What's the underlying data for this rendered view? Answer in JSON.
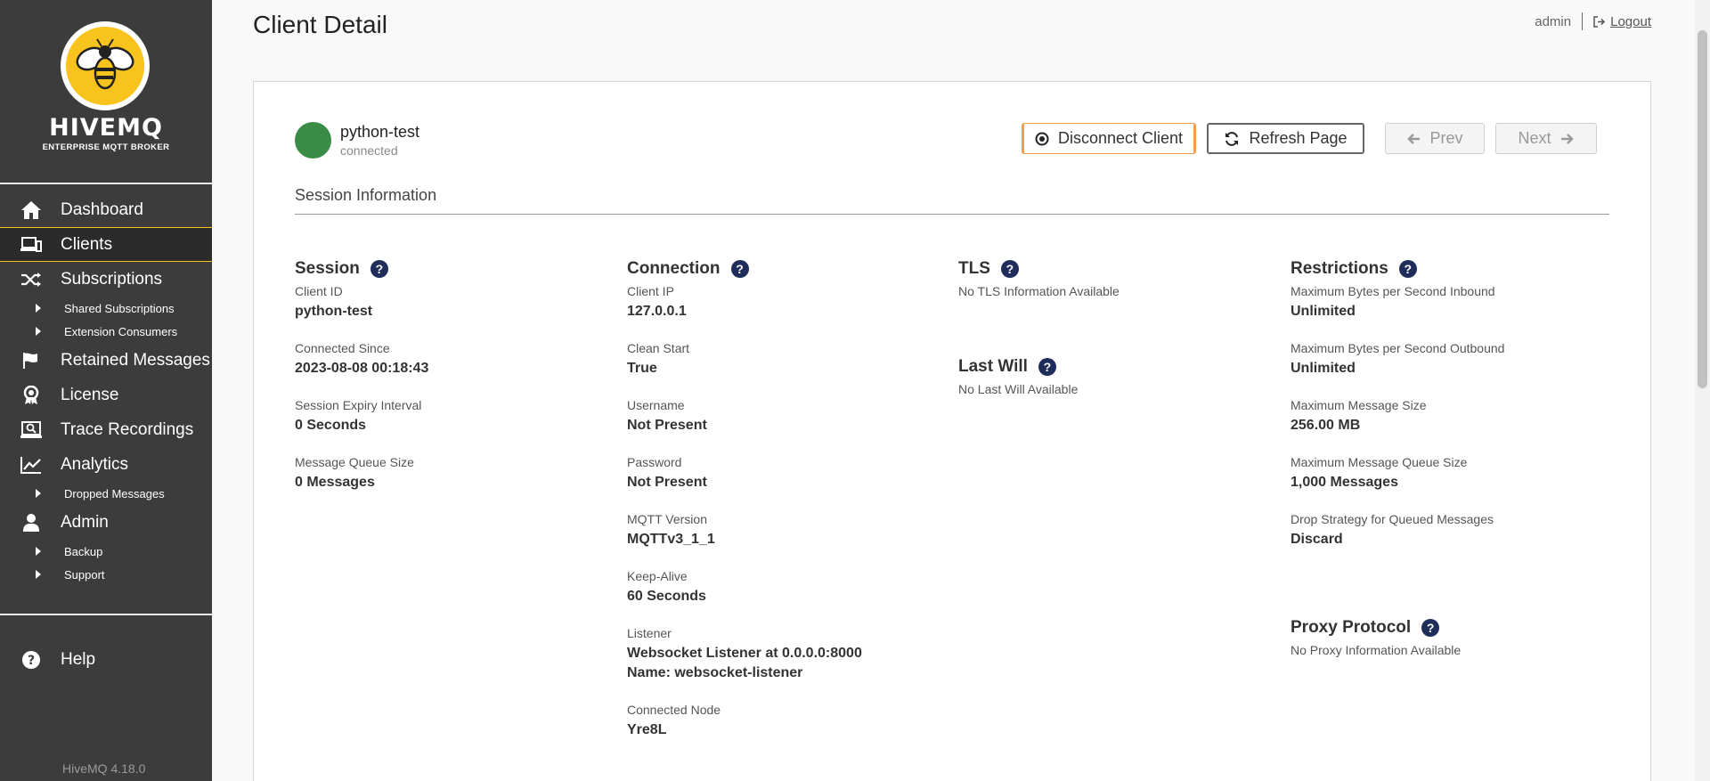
{
  "brand": {
    "name": "HIVEMQ",
    "subtitle": "ENTERPRISE MQTT BROKER",
    "accent": "#f7c31c",
    "sidebar_bg": "#3c3c3c"
  },
  "sidebar": {
    "items": [
      {
        "label": "Dashboard",
        "icon": "home-icon"
      },
      {
        "label": "Clients",
        "icon": "clients-icon",
        "active": true
      },
      {
        "label": "Subscriptions",
        "icon": "shuffle-icon"
      },
      {
        "label": "Shared Subscriptions",
        "sub": true
      },
      {
        "label": "Extension Consumers",
        "sub": true
      },
      {
        "label": "Retained Messages",
        "icon": "flag-icon"
      },
      {
        "label": "License",
        "icon": "award-icon"
      },
      {
        "label": "Trace Recordings",
        "icon": "trace-icon"
      },
      {
        "label": "Analytics",
        "icon": "line-chart-icon"
      },
      {
        "label": "Dropped Messages",
        "sub": true
      },
      {
        "label": "Admin",
        "icon": "user-icon"
      },
      {
        "label": "Backup",
        "sub": true
      },
      {
        "label": "Support",
        "sub": true
      }
    ],
    "help": "Help",
    "version": "HiveMQ 4.18.0"
  },
  "header": {
    "title": "Client Detail",
    "user": "admin",
    "logout": "Logout"
  },
  "client": {
    "id": "python-test",
    "status": "connected",
    "status_color": "#3a8b45"
  },
  "buttons": {
    "disconnect": "Disconnect Client",
    "refresh": "Refresh Page",
    "prev": "Prev",
    "next": "Next"
  },
  "section_title": "Session Information",
  "session": {
    "title": "Session",
    "fields": [
      {
        "label": "Client ID",
        "value": "python-test"
      },
      {
        "label": "Connected Since",
        "value": "2023-08-08 00:18:43"
      },
      {
        "label": "Session Expiry Interval",
        "value": "0 Seconds"
      },
      {
        "label": "Message Queue Size",
        "value": "0 Messages"
      }
    ]
  },
  "connection": {
    "title": "Connection",
    "fields": [
      {
        "label": "Client IP",
        "value": "127.0.0.1"
      },
      {
        "label": "Clean Start",
        "value": "True"
      },
      {
        "label": "Username",
        "value": "Not Present"
      },
      {
        "label": "Password",
        "value": "Not Present"
      },
      {
        "label": "MQTT Version",
        "value": "MQTTv3_1_1"
      },
      {
        "label": "Keep-Alive",
        "value": "60 Seconds"
      },
      {
        "label": "Listener",
        "value": "Websocket Listener at 0.0.0.0:8000",
        "value2": "Name: websocket-listener"
      },
      {
        "label": "Connected Node",
        "value": "Yre8L"
      }
    ]
  },
  "tls": {
    "title": "TLS",
    "note": "No TLS Information Available"
  },
  "last_will": {
    "title": "Last Will",
    "note": "No Last Will Available"
  },
  "restrictions": {
    "title": "Restrictions",
    "fields": [
      {
        "label": "Maximum Bytes per Second Inbound",
        "value": "Unlimited"
      },
      {
        "label": "Maximum Bytes per Second Outbound",
        "value": "Unlimited"
      },
      {
        "label": "Maximum Message Size",
        "value": "256.00 MB"
      },
      {
        "label": "Maximum Message Queue Size",
        "value": "1,000 Messages"
      },
      {
        "label": "Drop Strategy for Queued Messages",
        "value": "Discard"
      }
    ]
  },
  "proxy": {
    "title": "Proxy Protocol",
    "note": "No Proxy Information Available"
  }
}
